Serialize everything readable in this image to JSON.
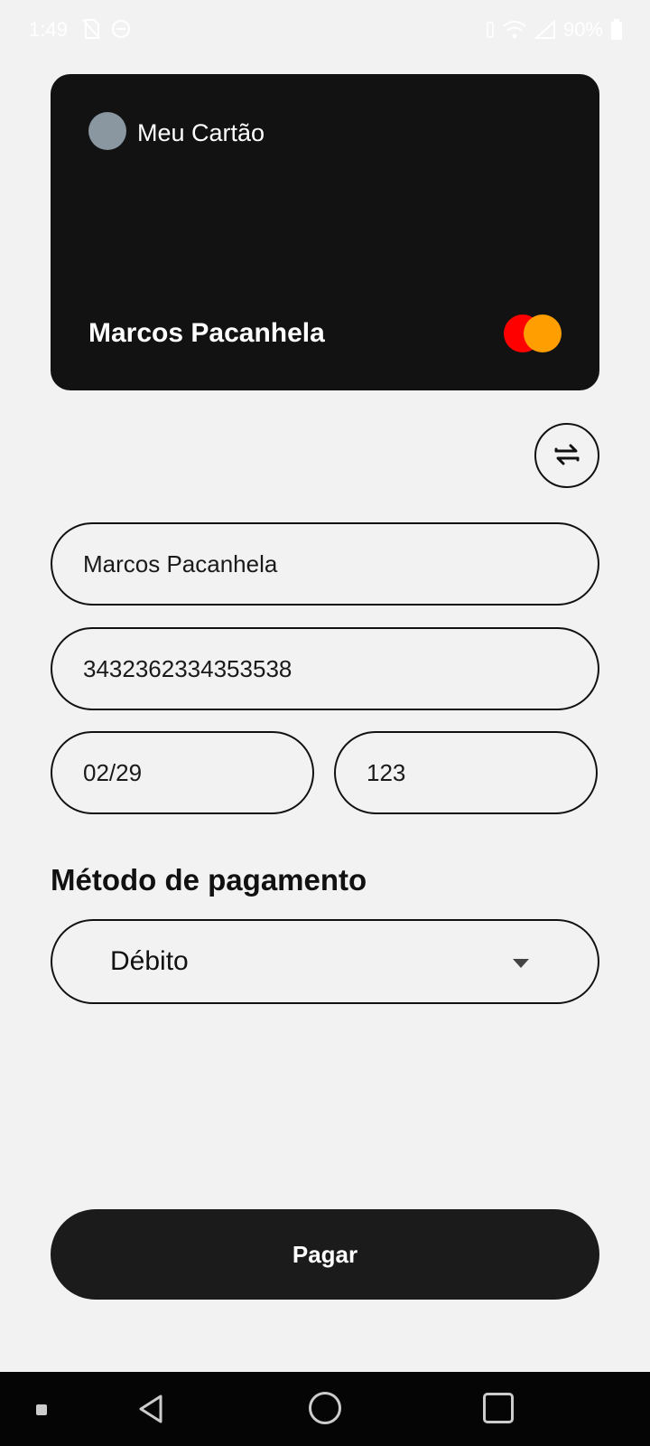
{
  "status_bar": {
    "time": "1:49",
    "battery": "90%",
    "icons": [
      "sim-off-icon",
      "dnd-icon",
      "vibrate-icon",
      "wifi-icon",
      "signal-icon",
      "battery-icon"
    ]
  },
  "card": {
    "label": "Meu Cartão",
    "holder": "Marcos Pacanhela",
    "brand_icon": "mastercard-logo",
    "colors": {
      "card_bg": "#121212",
      "chip": "#8a96a0",
      "brand_red": "#ff0000",
      "brand_orange": "#ff9e00"
    }
  },
  "swap_button_icon": "swap-arrows-icon",
  "form": {
    "name_value": "Marcos Pacanhela",
    "number_value": "3432362334353538",
    "expiry_value": "02/29",
    "cvv_value": "123"
  },
  "payment_method": {
    "title": "Método de pagamento",
    "selected": "Débito"
  },
  "pay_button": {
    "label": "Pagar"
  },
  "nav_bar": {
    "icons": [
      "recents-dot-icon",
      "back-icon",
      "home-icon",
      "overview-icon"
    ]
  }
}
